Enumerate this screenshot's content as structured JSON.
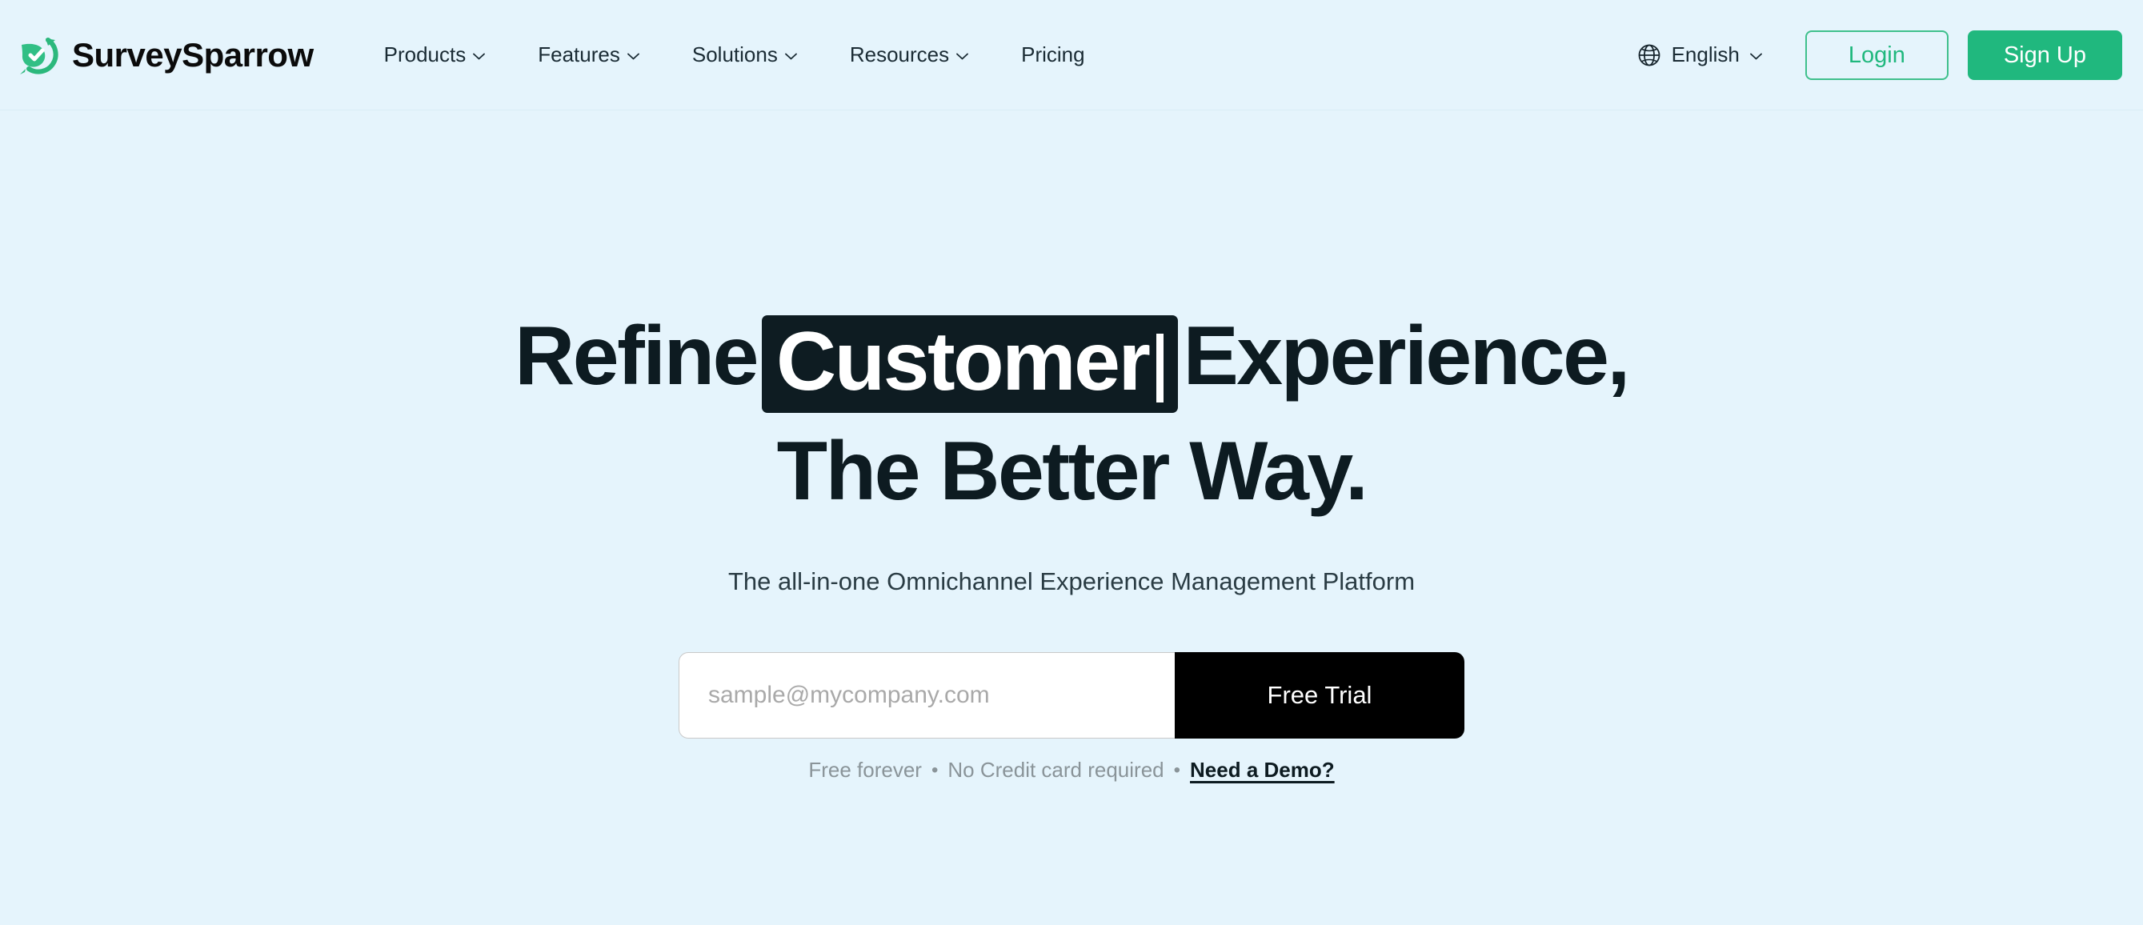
{
  "brand": {
    "name": "SurveySparrow",
    "logo_icon": "sparrow-leaf-check-icon",
    "accent_color": "#20b87e"
  },
  "header": {
    "nav": [
      {
        "label": "Products",
        "has_dropdown": true
      },
      {
        "label": "Features",
        "has_dropdown": true
      },
      {
        "label": "Solutions",
        "has_dropdown": true
      },
      {
        "label": "Resources",
        "has_dropdown": true
      },
      {
        "label": "Pricing",
        "has_dropdown": false
      }
    ],
    "language": {
      "icon": "globe-icon",
      "value": "English",
      "chevron": "chevron-down-icon"
    },
    "login_label": "Login",
    "signup_label": "Sign Up"
  },
  "hero": {
    "headline": {
      "line1_before": "Refine",
      "line1_highlight": "Customer",
      "line1_after": "Experience,",
      "line2": "The Better Way.",
      "highlight_bg": "#0e1c22",
      "highlight_fg": "#ffffff",
      "caret_visible": true
    },
    "subheadline": "The all-in-one Omnichannel Experience Management Platform",
    "form": {
      "email_placeholder": "sample@mycompany.com",
      "email_value": "",
      "submit_label": "Free Trial",
      "submit_bg": "#000000"
    },
    "note": {
      "part1": "Free forever",
      "separator1": "•",
      "part2": "No Credit card required",
      "separator2": "•",
      "link": "Need a Demo?"
    }
  },
  "page": {
    "background_color": "#e5f4fc",
    "text_color": "#0d1b21"
  }
}
